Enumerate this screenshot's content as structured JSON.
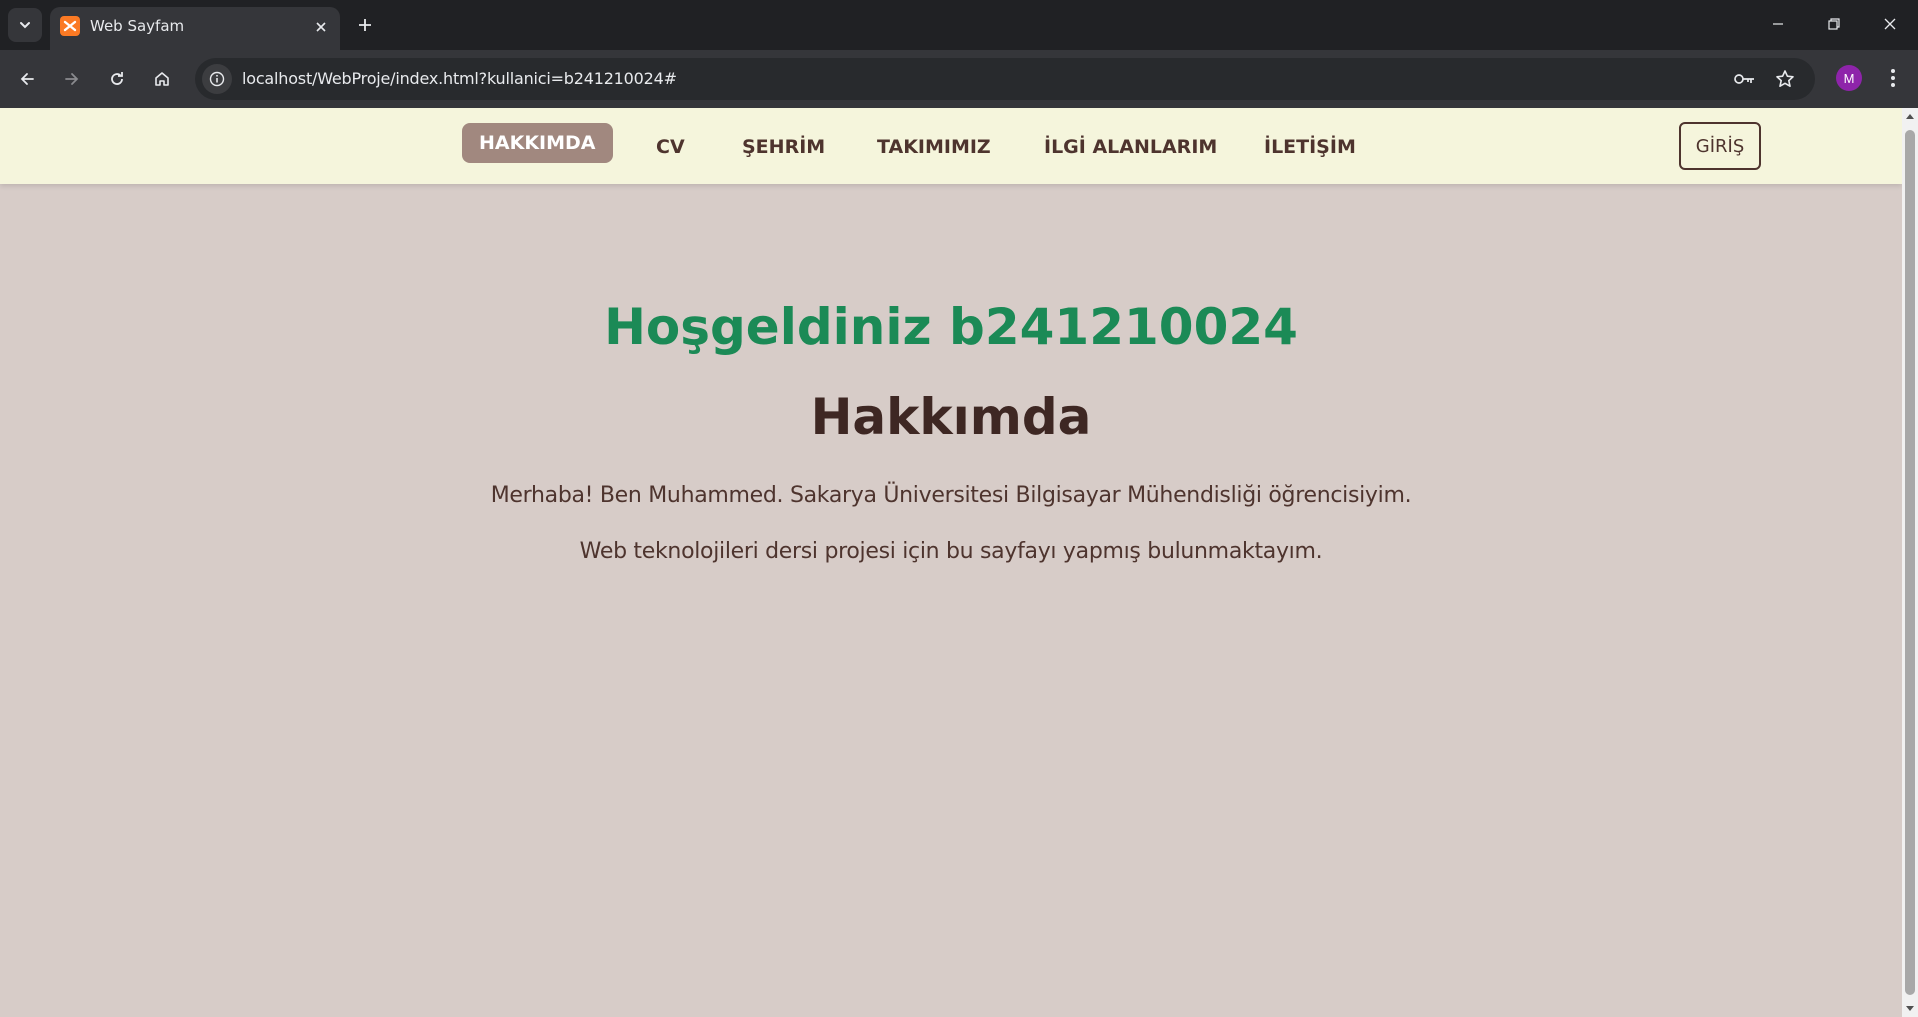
{
  "browser": {
    "tab_title": "Web Sayfam",
    "url": "localhost/WebProje/index.html?kullanici=b241210024#",
    "profile_initial": "M"
  },
  "nav": {
    "items": [
      {
        "label": "HAKKIMDA",
        "active": true
      },
      {
        "label": "CV"
      },
      {
        "label": "ŞEHRİM"
      },
      {
        "label": "TAKIMIMIZ"
      },
      {
        "label": "İLGİ ALANLARIM"
      },
      {
        "label": "İLETİŞİM"
      }
    ],
    "login_label": "GİRİŞ"
  },
  "main": {
    "welcome": "Hoşgeldiniz b241210024",
    "heading": "Hakkımda",
    "paragraphs": [
      "Merhaba! Ben Muhammed. Sakarya Üniversitesi Bilgisayar Mühendisliği öğrencisiyim.",
      "Web teknolojileri dersi projesi için bu sayfayı yapmış bulunmaktayım."
    ]
  },
  "colors": {
    "page_bg": "#d7ccc8",
    "nav_bg": "#f5f5dc",
    "accent_green": "#1b8a56",
    "brown": "#4e342e",
    "active_nav_bg": "#a1887f"
  }
}
